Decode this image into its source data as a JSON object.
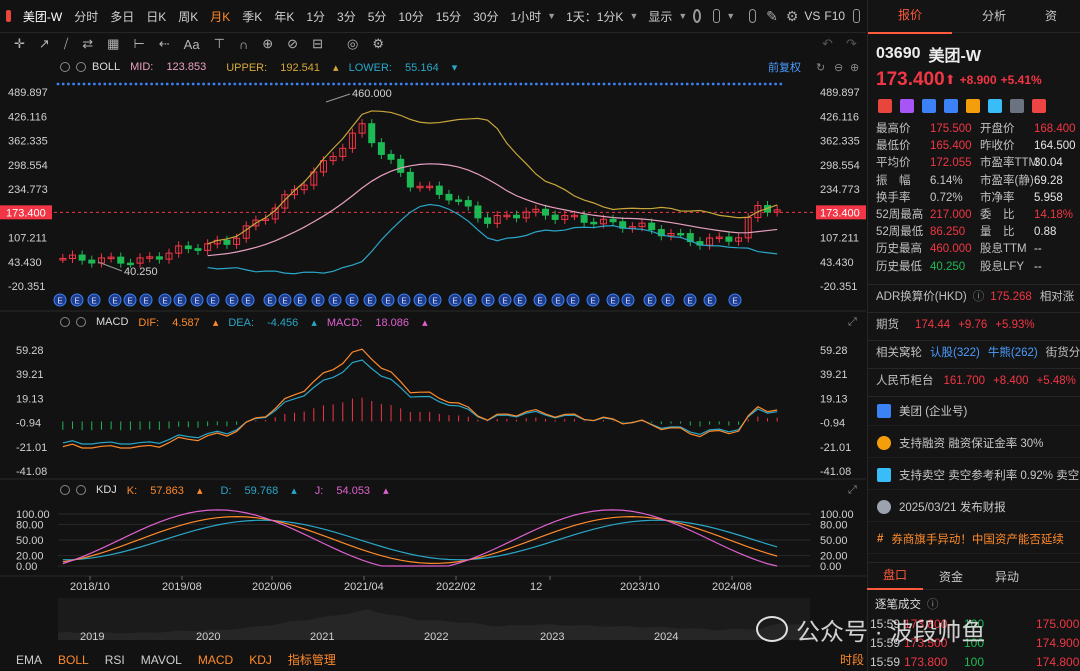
{
  "toolbar": {
    "symbol": "美团-W",
    "periods": [
      "分时",
      "多日",
      "日K",
      "周K",
      "月K",
      "季K",
      "年K",
      "1分",
      "3分",
      "5分",
      "10分",
      "15分",
      "30分",
      "1小时"
    ],
    "active_period": "月K",
    "range_select": "1天：1分K",
    "display_select": "显示",
    "vs_label": "VS",
    "f10_label": "F10"
  },
  "drawtools": [
    "✛",
    "↗",
    "⧸",
    "⇄",
    "▦",
    "⊢",
    "⇠",
    "Aa",
    "⊤",
    "∩",
    "⊕",
    "⊘",
    "⊟",
    "◎",
    "⚙"
  ],
  "main_panel": {
    "indicator": "BOLL",
    "mid_label": "MID:",
    "mid": "123.853",
    "upper_label": "UPPER:",
    "upper": "192.541",
    "lower_label": "LOWER:",
    "lower": "55.164",
    "adjust_label": "前复权",
    "y_ticks": [
      "489.897",
      "426.116",
      "362.335",
      "298.554",
      "234.773",
      "173.400",
      "107.211",
      "43.430",
      "-20.351"
    ],
    "current_price_tag": "173.400",
    "high_annotation": "460.000",
    "low_annotation": "40.250",
    "event_marker": "E"
  },
  "macd_panel": {
    "indicator": "MACD",
    "dif_label": "DIF:",
    "dif": "4.587",
    "dea_label": "DEA:",
    "dea": "-4.456",
    "macd_label": "MACD:",
    "macd": "18.086",
    "y_ticks": [
      "59.28",
      "39.21",
      "19.13",
      "-0.94",
      "-21.01",
      "-41.08"
    ]
  },
  "kdj_panel": {
    "indicator": "KDJ",
    "k_label": "K:",
    "k": "57.863",
    "d_label": "D:",
    "d": "59.768",
    "j_label": "J:",
    "j": "54.053",
    "y_ticks": [
      "100.00",
      "80.00",
      "50.00",
      "20.00",
      "0.00"
    ]
  },
  "x_axis": [
    "2018/10",
    "2019/08",
    "2020/06",
    "2021/04",
    "2022/02",
    "12",
    "2023/10",
    "2024/08"
  ],
  "navigator_axis": [
    "2019",
    "2020",
    "2021",
    "2022",
    "2023",
    "2024"
  ],
  "bottom_tabs": [
    "EMA",
    "BOLL",
    "RSI",
    "MAVOL",
    "MACD",
    "KDJ",
    "指标管理"
  ],
  "bottom_active": [
    "BOLL",
    "MACD",
    "KDJ"
  ],
  "bottom_right": "时段",
  "watermark": "公众号 · 波段帅鱼",
  "right": {
    "tabs": [
      "报价",
      "分析",
      "资"
    ],
    "code": "03690",
    "name": "美团-W",
    "price": "173.400",
    "arrow": "⬆",
    "change": "+8.900",
    "change_pct": "+5.41%",
    "stats": [
      [
        "最高价",
        "175.500",
        "up",
        "开盘价",
        "168.400",
        "up"
      ],
      [
        "最低价",
        "165.400",
        "up",
        "昨收价",
        "164.500",
        ""
      ],
      [
        "平均价",
        "172.055",
        "up",
        "市盈率TTM",
        "30.04",
        ""
      ],
      [
        "振　幅",
        "6.14%",
        "",
        "市盈率(静)",
        "69.28",
        ""
      ],
      [
        "换手率",
        "0.72%",
        "",
        "市净率",
        "5.958",
        ""
      ],
      [
        "52周最高",
        "217.000",
        "up",
        "委　比",
        "14.18%",
        "up"
      ],
      [
        "52周最低",
        "86.250",
        "up",
        "量　比",
        "0.88",
        ""
      ],
      [
        "历史最高",
        "460.000",
        "up",
        "股息TTM",
        "--",
        ""
      ],
      [
        "历史最低",
        "40.250",
        "dn",
        "股息LFY",
        "--",
        ""
      ]
    ],
    "adr_label": "ADR换算价(HKD)",
    "adr_value": "175.268",
    "adr_extra": "相对涨",
    "futures_label": "期货",
    "futures_price": "174.44",
    "futures_change": "+9.76",
    "futures_pct": "+5.93%",
    "warrants_label": "相关窝轮",
    "warrants_call": "认股(322)",
    "warrants_bull": "牛熊(262)",
    "warrants_extra": "街货分",
    "rmb_label": "人民币柜台",
    "rmb_price": "161.700",
    "rmb_change": "+8.400",
    "rmb_pct": "+5.48%",
    "features": [
      "美团 (企业号)",
      "支持融资 融资保证金率 30%",
      "支持卖空 卖空参考利率 0.92% 卖空",
      "2025/03/21  发布财报",
      "券商旗手异动！中国资产能否延续"
    ],
    "bottom_tabs": [
      "盘口",
      "资金",
      "异动"
    ],
    "ticks_label": "逐笔成交",
    "ticks": [
      [
        "15:59",
        "173.800",
        "100",
        "175.000"
      ],
      [
        "15:59",
        "173.500",
        "100",
        "174.900"
      ],
      [
        "15:59",
        "173.800",
        "100",
        "174.800"
      ]
    ],
    "ticks_qty_unit": "▾"
  },
  "colors": {
    "up": "#f23645",
    "down": "#1db954",
    "accent": "#ff8a2b",
    "boll_mid": "#e8a0c0",
    "boll_upper": "#c8a63a",
    "boll_lower": "#2aa6c8",
    "dif": "#ff8a2b",
    "dea": "#2aa6c8",
    "k": "#ff8a2b",
    "d": "#2aa6c8",
    "j": "#e060d0"
  }
}
